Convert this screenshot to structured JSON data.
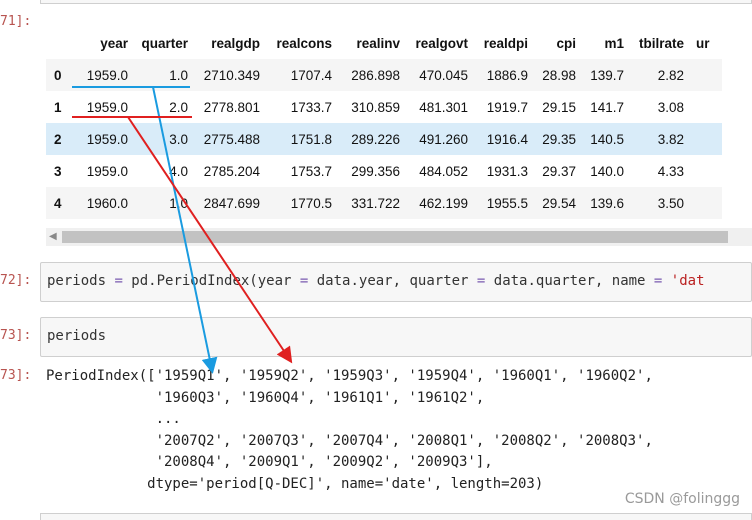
{
  "cell71": {
    "prompt": "71]:"
  },
  "table": {
    "columns": [
      "year",
      "quarter",
      "realgdp",
      "realcons",
      "realinv",
      "realgovt",
      "realdpi",
      "cpi",
      "m1",
      "tbilrate",
      "ur"
    ],
    "rows": [
      {
        "index": "0",
        "cells": [
          "1959.0",
          "1.0",
          "2710.349",
          "1707.4",
          "286.898",
          "470.045",
          "1886.9",
          "28.98",
          "139.7",
          "2.82",
          ""
        ]
      },
      {
        "index": "1",
        "cells": [
          "1959.0",
          "2.0",
          "2778.801",
          "1733.7",
          "310.859",
          "481.301",
          "1919.7",
          "29.15",
          "141.7",
          "3.08",
          ""
        ]
      },
      {
        "index": "2",
        "cells": [
          "1959.0",
          "3.0",
          "2775.488",
          "1751.8",
          "289.226",
          "491.260",
          "1916.4",
          "29.35",
          "140.5",
          "3.82",
          ""
        ]
      },
      {
        "index": "3",
        "cells": [
          "1959.0",
          "4.0",
          "2785.204",
          "1753.7",
          "299.356",
          "484.052",
          "1931.3",
          "29.37",
          "140.0",
          "4.33",
          ""
        ]
      },
      {
        "index": "4",
        "cells": [
          "1960.0",
          "1.0",
          "2847.699",
          "1770.5",
          "331.722",
          "462.199",
          "1955.5",
          "29.54",
          "139.6",
          "3.50",
          ""
        ]
      }
    ]
  },
  "cell72": {
    "prompt": "72]:",
    "code": {
      "a": "periods ",
      "op1": "=",
      "b": " pd.PeriodIndex(year ",
      "op2": "=",
      "c": " data.year, quarter ",
      "op3": "=",
      "d": " data.quarter, name ",
      "op4": "=",
      "e": " ",
      "s": "'dat"
    }
  },
  "cell73": {
    "prompt_in": "73]:",
    "code": "periods",
    "prompt_out": "73]:",
    "output": [
      "PeriodIndex(['1959Q1', '1959Q2', '1959Q3', '1959Q4', '1960Q1', '1960Q2',",
      "             '1960Q3', '1960Q4', '1961Q1', '1961Q2',",
      "             ...",
      "             '2007Q2', '2007Q3', '2007Q4', '2008Q1', '2008Q2', '2008Q3',",
      "             '2008Q4', '2009Q1', '2009Q2', '2009Q3'],",
      "            dtype='period[Q-DEC]', name='date', length=203)"
    ]
  },
  "watermark": "CSDN @folinggg",
  "colors": {
    "annotation_blue": "#1a9be0",
    "annotation_red": "#e02020",
    "prompt_red": "#b85450",
    "selected_row": "#d9ecf9"
  }
}
